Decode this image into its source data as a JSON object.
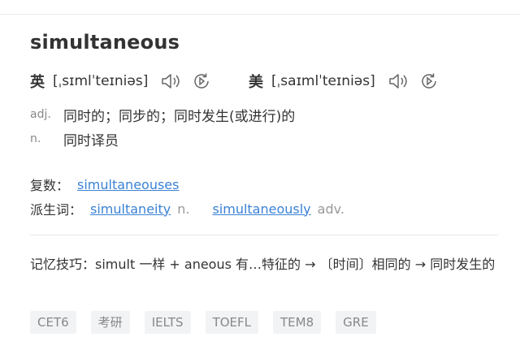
{
  "entry": {
    "word": "simultaneous",
    "pronunciations": [
      {
        "region": "英",
        "ipa": "[ˌsɪmlˈteɪniəs]",
        "audio_icon": "speaker-icon",
        "repeat_icon": "repeat-play-icon"
      },
      {
        "region": "美",
        "ipa": "[ˌsaɪmlˈteɪniəs]",
        "audio_icon": "speaker-icon",
        "repeat_icon": "repeat-play-icon"
      }
    ],
    "definitions": [
      {
        "pos": "adj.",
        "meaning": "同时的；同步的；同时发生(或进行)的"
      },
      {
        "pos": "n.",
        "meaning": "同时译员"
      }
    ],
    "plural": {
      "label": "复数：",
      "value": "simultaneouses"
    },
    "derivatives": {
      "label": "派生词：",
      "items": [
        {
          "word": "simultaneity",
          "pos": "n."
        },
        {
          "word": "simultaneously",
          "pos": "adv."
        }
      ]
    },
    "memory_tip": "记忆技巧：simult 一样 + aneous 有…特征的 → 〔时间〕相同的 → 同时发生的",
    "exam_tags": [
      "CET6",
      "考研",
      "IELTS",
      "TOEFL",
      "TEM8",
      "GRE"
    ]
  },
  "colors": {
    "link": "#3b82d4",
    "text": "#333333",
    "muted": "#888888",
    "chip_bg": "#f2f3f5"
  }
}
